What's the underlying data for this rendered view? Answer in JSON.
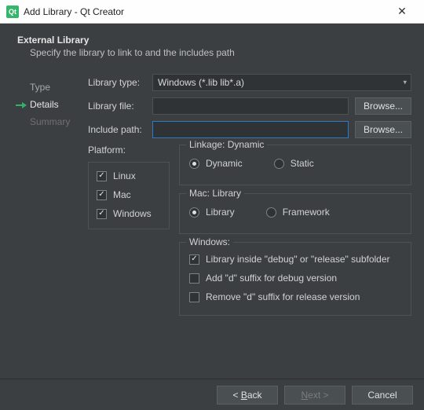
{
  "titlebar": {
    "title": "Add Library - Qt Creator"
  },
  "header": {
    "title": "External Library",
    "subtitle": "Specify the library to link to and the includes path"
  },
  "nav": {
    "type": "Type",
    "details": "Details",
    "summary": "Summary"
  },
  "form": {
    "library_type_label": "Library type:",
    "library_type_value": "Windows (*.lib lib*.a)",
    "library_file_label": "Library file:",
    "library_file_value": "",
    "include_path_label": "Include path:",
    "include_path_value": "",
    "browse_label": "Browse...",
    "platform_label": "Platform:",
    "platforms": {
      "linux": "Linux",
      "mac": "Mac",
      "windows": "Windows"
    },
    "linkage": {
      "title": "Linkage: Dynamic",
      "dynamic": "Dynamic",
      "static": "Static"
    },
    "maclib": {
      "title": "Mac: Library",
      "library": "Library",
      "framework": "Framework"
    },
    "winbox": {
      "title": "Windows:",
      "opt1": "Library inside \"debug\" or \"release\" subfolder",
      "opt2": "Add \"d\" suffix for debug version",
      "opt3": "Remove \"d\" suffix for release version"
    }
  },
  "footer": {
    "back_pre": "< ",
    "back_u": "B",
    "back_post": "ack",
    "next_u": "N",
    "next_post": "ext >",
    "cancel": "Cancel"
  }
}
